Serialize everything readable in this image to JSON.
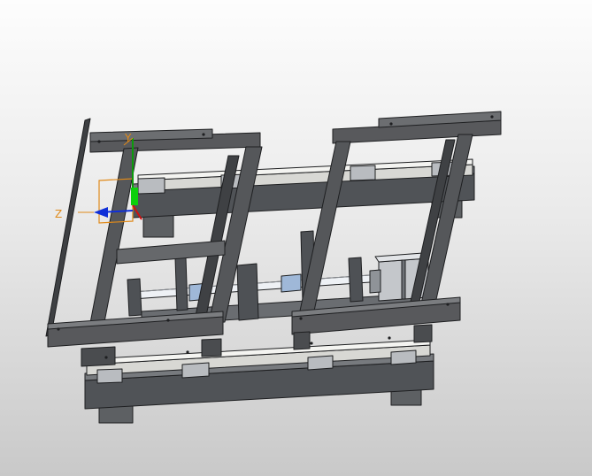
{
  "viewport": {
    "background_top": "#fdfdfd",
    "background_bottom": "#c9c9c9"
  },
  "triad": {
    "x_label": "",
    "y_label": "Y",
    "z_label": "Z",
    "x_color": "#d01010",
    "y_color": "#0c9a0c",
    "z_color": "#1030d8",
    "origin_box_color": "#e08a1a"
  },
  "model": {
    "frame_color": "#56585b",
    "frame_edge": "#1e1f21",
    "rail_color": "#d8d8d4",
    "block_color": "#b9bcc0",
    "motor_color": "#c4c7cb",
    "shaft_color": "#eef1f5",
    "coupling_color": "#9fb8d8",
    "icon": "3d-assembly-model"
  }
}
